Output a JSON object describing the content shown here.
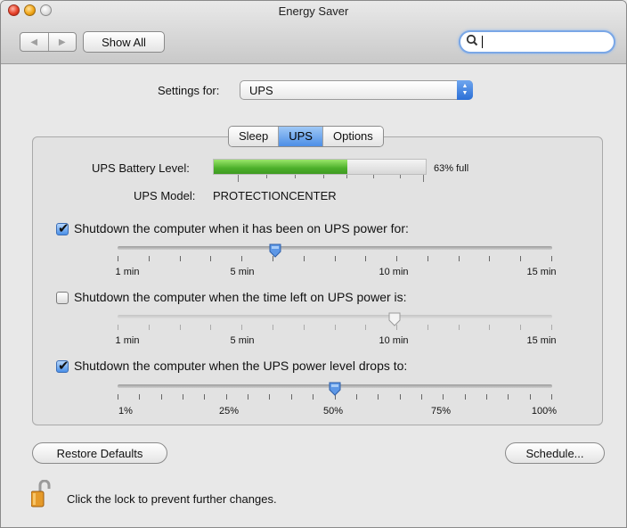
{
  "window": {
    "title": "Energy Saver"
  },
  "toolbar": {
    "show_all": "Show All",
    "search_value": ""
  },
  "settings_for": {
    "label": "Settings for:",
    "value": "UPS"
  },
  "tabs": [
    {
      "label": "Sleep",
      "active": false
    },
    {
      "label": "UPS",
      "active": true
    },
    {
      "label": "Options",
      "active": false
    }
  ],
  "ups": {
    "battery_label": "UPS Battery Level:",
    "battery_percent": 63,
    "battery_text": "63% full",
    "model_label": "UPS Model:",
    "model_value": "PROTECTIONCENTER"
  },
  "shutdown_options": [
    {
      "label": "Shutdown the computer when it has been on UPS power for:",
      "checked": true,
      "ticks": [
        "1 min",
        "5 min",
        "10 min",
        "15 min"
      ],
      "value": "6 min"
    },
    {
      "label": "Shutdown the computer when the time left on UPS power is:",
      "checked": false,
      "ticks": [
        "1 min",
        "5 min",
        "10 min",
        "15 min"
      ],
      "value": "10 min"
    },
    {
      "label": "Shutdown the computer when the UPS power level drops to:",
      "checked": true,
      "ticks": [
        "1%",
        "25%",
        "50%",
        "75%",
        "100%"
      ],
      "value": "50%"
    }
  ],
  "buttons": {
    "restore_defaults": "Restore Defaults",
    "schedule": "Schedule..."
  },
  "lock": {
    "text": "Click the lock to prevent further changes."
  },
  "colors": {
    "accent": "#4c8ee6",
    "battery_fill": "#4cb02a"
  }
}
